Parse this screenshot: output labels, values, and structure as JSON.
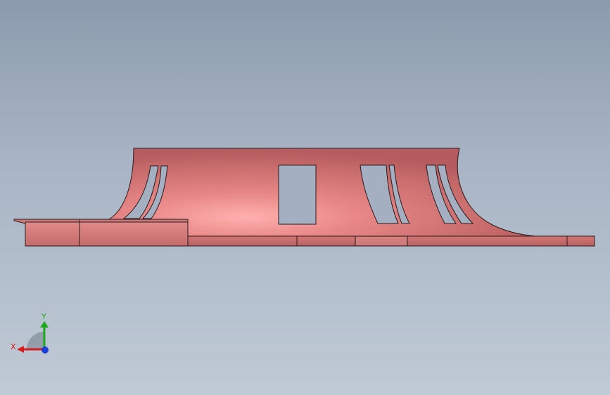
{
  "viewport": {
    "background_top": "#8b9bad",
    "background_bottom": "#c0cad6"
  },
  "model": {
    "name": "impeller-part",
    "color": "#d9706f",
    "edge_color": "#2a1a1a"
  },
  "triad": {
    "x_label": "X",
    "y_label": "Y",
    "x_color": "#d81e1e",
    "y_color": "#1ea81e",
    "z_color": "#1e3ed8"
  }
}
